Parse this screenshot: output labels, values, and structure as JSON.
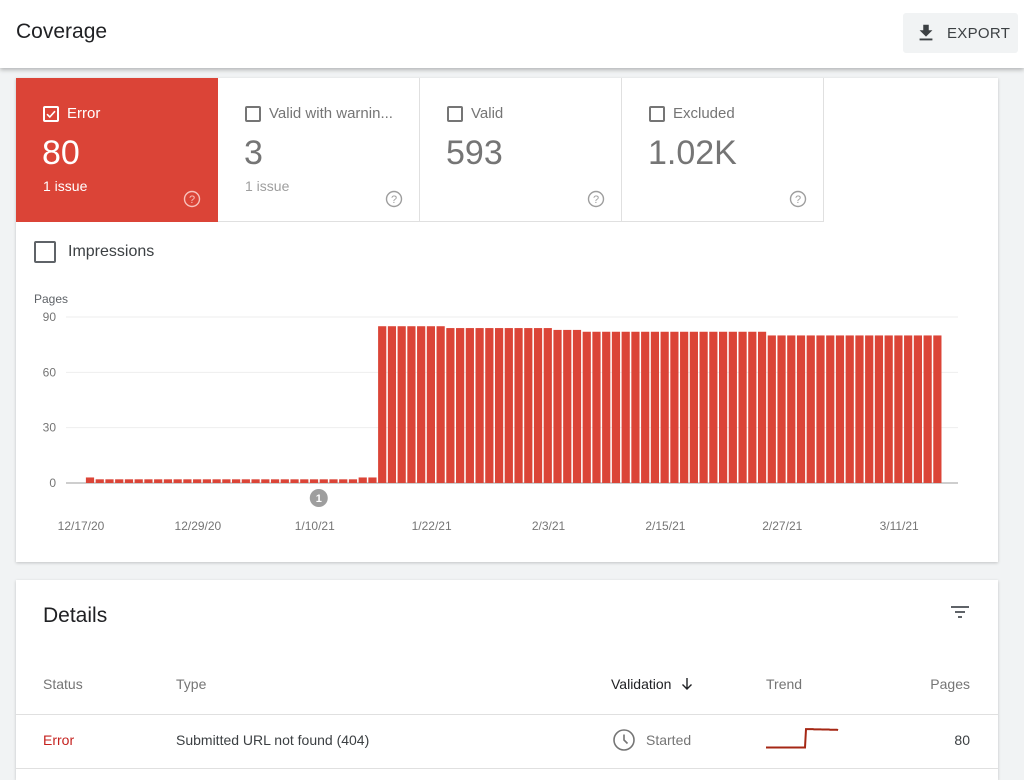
{
  "header": {
    "title": "Coverage",
    "export_label": "EXPORT"
  },
  "tiles": [
    {
      "label": "Error",
      "value": "80",
      "sub": "1 issue",
      "checked": true,
      "color": "#db4437"
    },
    {
      "label": "Valid with warnin...",
      "value": "3",
      "sub": "1 issue",
      "checked": false
    },
    {
      "label": "Valid",
      "value": "593",
      "sub": "",
      "checked": false
    },
    {
      "label": "Excluded",
      "value": "1.02K",
      "sub": "",
      "checked": false
    }
  ],
  "impressions_label": "Impressions",
  "chart_data": {
    "type": "bar",
    "title": "",
    "ylabel": "Pages",
    "xlabel": "",
    "ylim": [
      0,
      90
    ],
    "yticks": [
      0,
      30,
      60,
      90
    ],
    "xtick_labels": [
      "12/17/20",
      "12/29/20",
      "1/10/21",
      "1/22/21",
      "2/3/21",
      "2/15/21",
      "2/27/21",
      "3/11/21"
    ],
    "start_date": "12/17/20",
    "annotation": {
      "label": "1",
      "date": "1/10/21"
    },
    "bar_color": "#db4437",
    "grid": true,
    "values": [
      3,
      2,
      2,
      2,
      2,
      2,
      2,
      2,
      2,
      2,
      2,
      2,
      2,
      2,
      2,
      2,
      2,
      2,
      2,
      2,
      2,
      2,
      2,
      2,
      2,
      2,
      2,
      2,
      3,
      3,
      85,
      85,
      85,
      85,
      85,
      85,
      85,
      84,
      84,
      84,
      84,
      84,
      84,
      84,
      84,
      84,
      84,
      84,
      83,
      83,
      83,
      82,
      82,
      82,
      82,
      82,
      82,
      82,
      82,
      82,
      82,
      82,
      82,
      82,
      82,
      82,
      82,
      82,
      82,
      82,
      80,
      80,
      80,
      80,
      80,
      80,
      80,
      80,
      80,
      80,
      80,
      80,
      80,
      80,
      80,
      80,
      80,
      80
    ]
  },
  "details": {
    "title": "Details",
    "columns": [
      "Status",
      "Type",
      "Validation",
      "Trend",
      "Pages"
    ],
    "sorted_column": "Validation",
    "rows": [
      {
        "status": "Error",
        "type": "Submitted URL not found (404)",
        "validation": "Started",
        "pages": "80",
        "trend": [
          2,
          2,
          2,
          2,
          2,
          85,
          84,
          83,
          82,
          80
        ]
      }
    ]
  }
}
